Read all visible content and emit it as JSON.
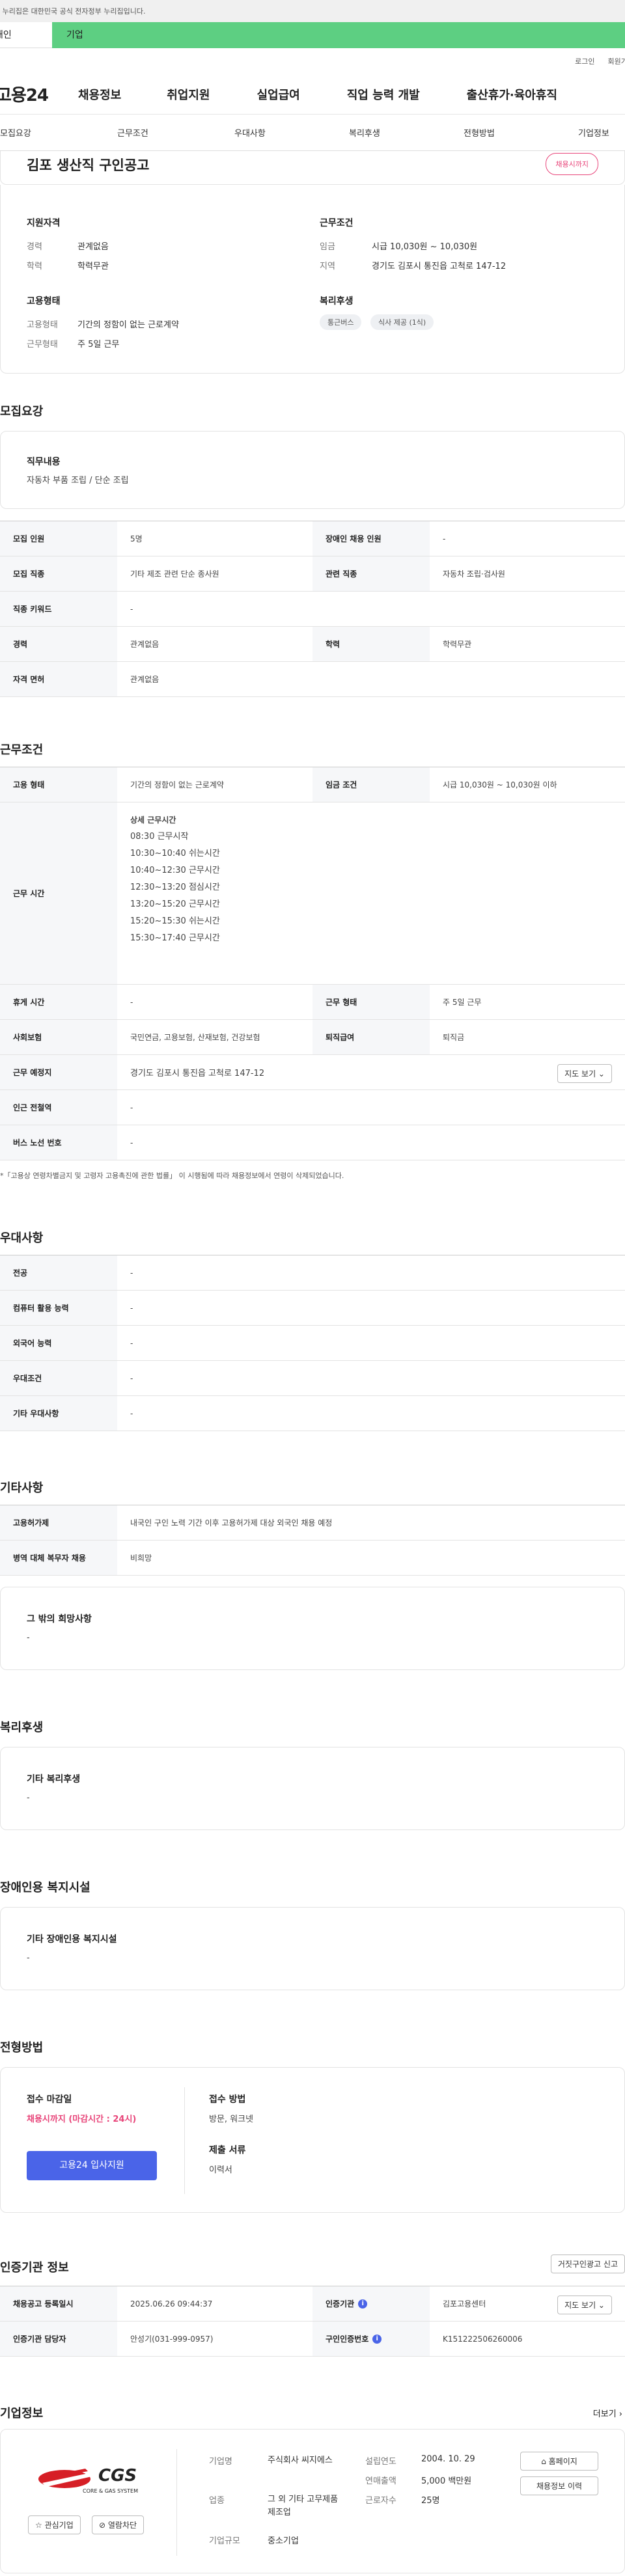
{
  "gov_bar_text": "이 누리집은 대한민국 공식 전자정부 누리집입니다.",
  "audience_tabs": [
    "개인",
    "기업"
  ],
  "util_links": [
    "로그인",
    "회원가입"
  ],
  "gnb": {
    "logo": "고용24",
    "menus": [
      "채용정보",
      "취업지원",
      "실업급여",
      "직업 능력 개발",
      "출산휴가·육아휴직"
    ]
  },
  "subnav": [
    "모집요강",
    "근무조건",
    "우대사항",
    "복리후생",
    "전형방법",
    "기업정보"
  ],
  "job": {
    "title": "김포 생산직 구인공고",
    "badge": "채용시까지",
    "qual_title": "지원자격",
    "career_k": "경력",
    "career_v": "관계없음",
    "edu_k": "학력",
    "edu_v": "학력무관",
    "cond_title": "근무조건",
    "wage_k": "임금",
    "wage_v": "시급 10,030원 ~ 10,030원",
    "area_k": "지역",
    "area_v": "경기도 김포시 통진읍 고척로 147-12",
    "emp_title": "고용형태",
    "emptype_k": "고용형태",
    "emptype_v": "기간의 정함이 없는 근로계약",
    "workform_k": "근무형태",
    "workform_v": "주 5일 근무",
    "welfare_title": "복리후생",
    "chips": [
      "통근버스",
      "식사 제공 (1식)"
    ]
  },
  "recruit": {
    "section_title": "모집요강",
    "duty_h": "직무내용",
    "duty_t": "자동차 부품 조립 / 단순 조립",
    "rows": [
      {
        "k1": "모집 인원",
        "v1": "5명",
        "k2": "장애인 채용 인원",
        "v2": "-"
      },
      {
        "k1": "모집 직종",
        "v1": "기타 제조 관련 단순 종사원",
        "k2": "관련 직종",
        "v2": "자동차 조립·검사원"
      },
      {
        "k1": "직종 키워드",
        "v1": "-"
      },
      {
        "k1": "경력",
        "v1": "관계없음",
        "k2": "학력",
        "v2": "학력무관"
      },
      {
        "k1": "자격 면허",
        "v1": "관계없음"
      }
    ]
  },
  "work": {
    "section_title": "근무조건",
    "emp_k": "고용 형태",
    "emp_v": "기간의 정함이 없는 근로계약",
    "wage_k": "임금 조건",
    "wage_v": "시급 10,030원 ~ 10,030원 이하",
    "time_k": "근무 시간",
    "time_lines": [
      "상세 근무시간",
      "08:30 근무시작",
      "10:30~10:40 쉬는시간",
      "10:40~12:30 근무시간",
      "12:30~13:20 점심시간",
      "13:20~15:20 근무시간",
      "15:20~15:30 쉬는시간",
      "15:30~17:40 근무시간"
    ],
    "rest_k": "휴게 시간",
    "rest_v": "-",
    "form_k": "근무 형태",
    "form_v": "주 5일 근무",
    "ins_k": "사회보험",
    "ins_v": "국민연금, 고용보험, 산재보험, 건강보험",
    "ret_k": "퇴직급여",
    "ret_v": "퇴직금",
    "place_k": "근무 예정지",
    "place_v": "경기도 김포시 통진읍 고척로 147-12",
    "map_btn": "지도 보기 ⌄",
    "sub_k": "인근 전철역",
    "sub_v": "-",
    "bus_k": "버스 노선 번호",
    "bus_v": "-",
    "note": "*「고용상 연령차별금지 및 고령자 고용촉진에 관한 법률」 이 시행됨에 따라 채용정보에서 연령이 삭제되었습니다."
  },
  "pref": {
    "section_title": "우대사항",
    "rows": [
      [
        "전공",
        "-"
      ],
      [
        "컴퓨터 활용 능력",
        "-"
      ],
      [
        "외국어 능력",
        "-"
      ],
      [
        "우대조건",
        "-"
      ],
      [
        "기타 우대사항",
        "-"
      ]
    ]
  },
  "etc": {
    "section_title": "기타사항",
    "rows": [
      [
        "고용허가제",
        "내국인 구인 노력 기간 이후 고용허가제 대상 외국인 채용 예정"
      ],
      [
        "병역 대체 복무자 채용",
        "비희망"
      ]
    ],
    "other_h": "그 밖의 희망사항",
    "other_t": "-"
  },
  "welfare": {
    "section_title": "복리후생",
    "h": "기타 복리후생",
    "t": "-"
  },
  "disabled": {
    "section_title": "장애인용 복지시설",
    "h": "기타 장애인용 복지시설",
    "t": "-"
  },
  "process": {
    "section_title": "전형방법",
    "deadline_h": "접수 마감일",
    "deadline_v": "채용시까지 (마감시간 : 24시)",
    "apply_btn": "고용24 입사지원",
    "method_h": "접수 방법",
    "method_v": "방문, 워크넷",
    "docs_h": "제출 서류",
    "docs_v": "이력서"
  },
  "agency": {
    "section_title": "인증기관 정보",
    "report_btn": "거짓구인광고 신고",
    "reg_k": "채용공고 등록일시",
    "reg_v": "2025.06.26 09:44:37",
    "org_k": "인증기관",
    "org_v": "김포고용센터",
    "map_btn": "지도 보기 ⌄",
    "mgr_k": "인증기관 담당자",
    "mgr_v": "안성기(031-999-0957)",
    "num_k": "구인인증번호",
    "num_v": "K151222506260006"
  },
  "company": {
    "section_title": "기업정보",
    "more": "더보기 ›",
    "logo_text": "CGS",
    "logo_sub": "CORE & GAS SYSTEM",
    "fav_btn": "☆ 관심기업",
    "block_btn": "⊘ 열람차단",
    "name_k": "기업명",
    "name_v": "주식회사 씨지에스",
    "biz_k": "업종",
    "biz_v": "그 외 기타 고무제품 제조업",
    "size_k": "기업규모",
    "size_v": "중소기업",
    "est_k": "설립연도",
    "est_v": "2004. 10. 29",
    "sales_k": "연매출액",
    "sales_v": "5,000 백만원",
    "emp_k": "근로자수",
    "emp_v": "25명",
    "home_btn": "⌂ 홈페이지",
    "hist_btn": "채용정보 이력"
  },
  "colors": {
    "accent": "#4a64e8",
    "badge": "#e8457a",
    "topbar": "#5dcf82"
  }
}
